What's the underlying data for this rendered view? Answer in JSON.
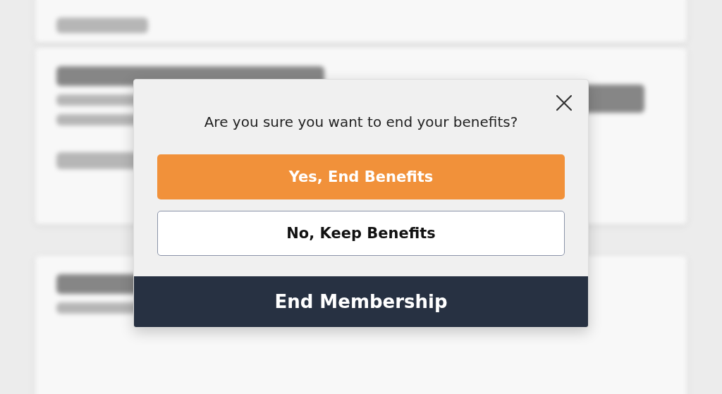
{
  "dialog": {
    "question": "Are you sure you want to end your benefits?",
    "buttons": [
      {
        "label": "Yes, End Benefits",
        "kind": "primary"
      },
      {
        "label": "No, Keep Benefits",
        "kind": "secondary"
      }
    ],
    "footer": {
      "label": "End Membership"
    }
  }
}
